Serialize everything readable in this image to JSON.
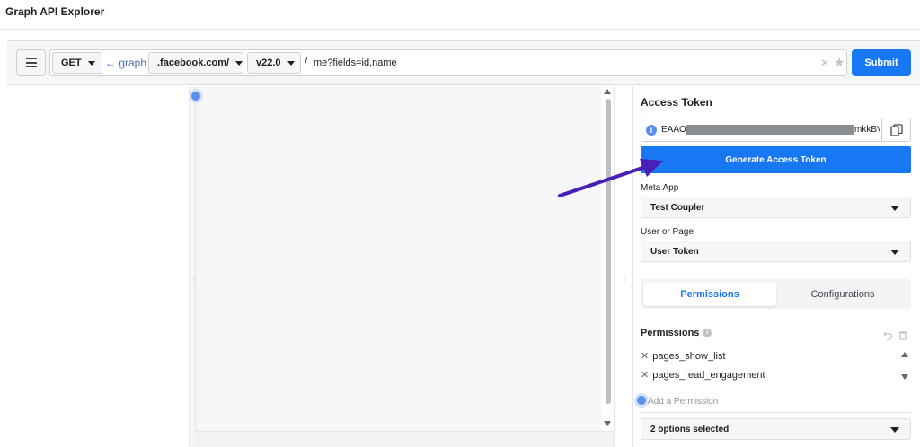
{
  "app": {
    "title": "Graph API Explorer"
  },
  "toolbar": {
    "method": "GET",
    "graph_link": "← graph.",
    "domain": ".facebook.com/",
    "version": "v22.0",
    "slash": "/",
    "path": "me?fields=id,name",
    "submit_label": "Submit"
  },
  "access_token": {
    "heading": "Access Token",
    "token_start": "EAAO",
    "token_end": "mkkBV",
    "generate_label": "Generate Access Token"
  },
  "meta_app": {
    "label": "Meta App",
    "value": "Test Coupler"
  },
  "user_or_page": {
    "label": "User or Page",
    "value": "User Token"
  },
  "tabs": [
    {
      "label": "Permissions",
      "active": true
    },
    {
      "label": "Configurations",
      "active": false
    }
  ],
  "permissions": {
    "heading": "Permissions",
    "items": [
      "pages_show_list",
      "pages_read_engagement"
    ],
    "add_placeholder": "Add a Permission",
    "options_selected": "2 options selected"
  },
  "colors": {
    "brand_blue": "#1877f2",
    "arrow": "#4a1fb5"
  }
}
